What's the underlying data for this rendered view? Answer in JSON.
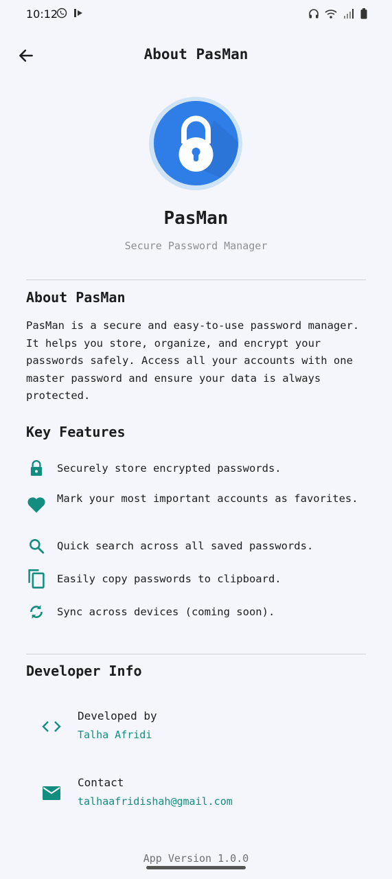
{
  "status_bar": {
    "time": "10:12",
    "left_icons": [
      "whatsapp-icon",
      "media-icon"
    ],
    "right_icons": [
      "headphones-icon",
      "wifi-icon",
      "signal-icon",
      "battery-icon"
    ]
  },
  "app_bar": {
    "back_icon": "arrow-left-icon",
    "title": "About PasMan"
  },
  "header": {
    "logo_icon": "padlock-icon",
    "app_name": "PasMan",
    "tagline": "Secure Password Manager"
  },
  "about": {
    "title": "About PasMan",
    "body": "PasMan is a secure and easy-to-use password manager. It helps you store, organize, and encrypt your passwords safely. Access all your accounts with one master password and ensure your data is always protected."
  },
  "features": {
    "title": "Key Features",
    "items": [
      {
        "icon": "lock-icon",
        "text": "Securely store encrypted passwords."
      },
      {
        "icon": "heart-icon",
        "text": "Mark your most important accounts as favorites."
      },
      {
        "icon": "search-icon",
        "text": "Quick search across all saved passwords."
      },
      {
        "icon": "copy-icon",
        "text": "Easily copy passwords to clipboard."
      },
      {
        "icon": "sync-icon",
        "text": "Sync across devices (coming soon)."
      }
    ]
  },
  "developer": {
    "title": "Developer Info",
    "developed_by_label": "Developed by",
    "developer_name": "Talha Afridi",
    "contact_label": "Contact",
    "contact_email": "talhaafridishah@gmail.com"
  },
  "footer": {
    "version": "App Version 1.0.0"
  },
  "colors": {
    "accent": "#138d80",
    "logo_blue": "#2f7de6",
    "background": "#f4f6fb"
  }
}
